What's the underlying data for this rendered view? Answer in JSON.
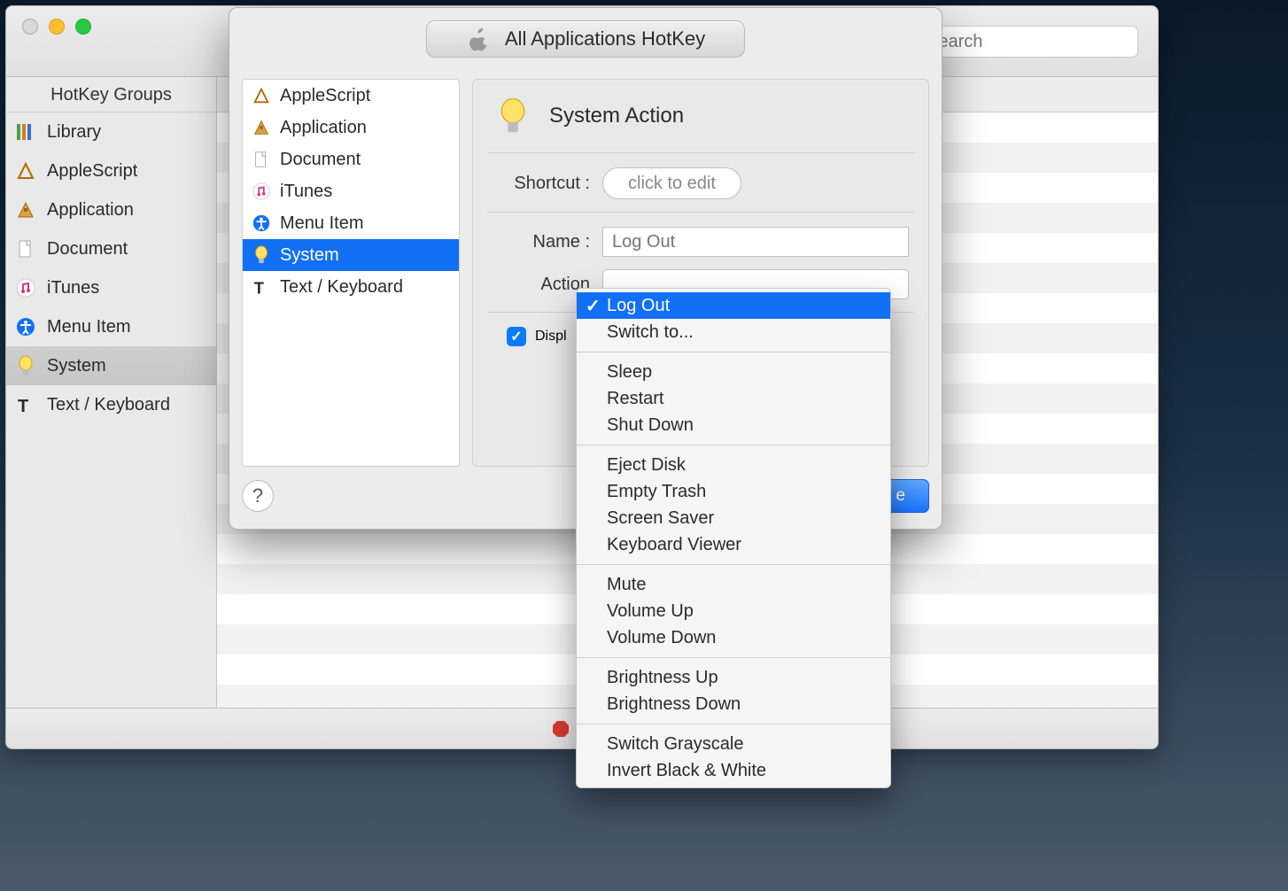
{
  "window": {
    "title": "All Applications HotKey",
    "search_placeholder": "Search"
  },
  "sidebar": {
    "header": "HotKey Groups",
    "items": [
      {
        "label": "Library",
        "icon": "books-icon"
      },
      {
        "label": "AppleScript",
        "icon": "applescript-icon"
      },
      {
        "label": "Application",
        "icon": "application-icon"
      },
      {
        "label": "Document",
        "icon": "document-icon"
      },
      {
        "label": "iTunes",
        "icon": "itunes-icon"
      },
      {
        "label": "Menu Item",
        "icon": "accessibility-icon"
      },
      {
        "label": "System",
        "icon": "bulb-icon"
      },
      {
        "label": "Text / Keyboard",
        "icon": "text-icon"
      }
    ],
    "selected_index": 6
  },
  "type_list": {
    "items": [
      {
        "label": "AppleScript",
        "icon": "applescript-icon"
      },
      {
        "label": "Application",
        "icon": "application-icon"
      },
      {
        "label": "Document",
        "icon": "document-icon"
      },
      {
        "label": "iTunes",
        "icon": "itunes-icon"
      },
      {
        "label": "Menu Item",
        "icon": "accessibility-icon"
      },
      {
        "label": "System",
        "icon": "bulb-icon"
      },
      {
        "label": "Text / Keyboard",
        "icon": "text-icon"
      }
    ],
    "selected_index": 5
  },
  "panel": {
    "title": "System Action",
    "shortcut_label": "Shortcut :",
    "shortcut_placeholder": "click to edit",
    "name_label": "Name :",
    "name_value": "Log Out",
    "action_label": "Action",
    "display_label_partial": "Displ",
    "display_checked": true
  },
  "popup": {
    "selected_index": 0,
    "groups": [
      [
        "Log Out",
        "Switch to..."
      ],
      [
        "Sleep",
        "Restart",
        "Shut Down"
      ],
      [
        "Eject Disk",
        "Empty Trash",
        "Screen Saver",
        "Keyboard Viewer"
      ],
      [
        "Mute",
        "Volume Up",
        "Volume Down"
      ],
      [
        "Brightness Up",
        "Brightness Down"
      ],
      [
        "Switch Grayscale",
        "Invert Black & White"
      ]
    ]
  },
  "footer": {
    "help": "?",
    "create_partial": "e"
  },
  "statusbar": {
    "stop_label_partial": "Stop"
  }
}
